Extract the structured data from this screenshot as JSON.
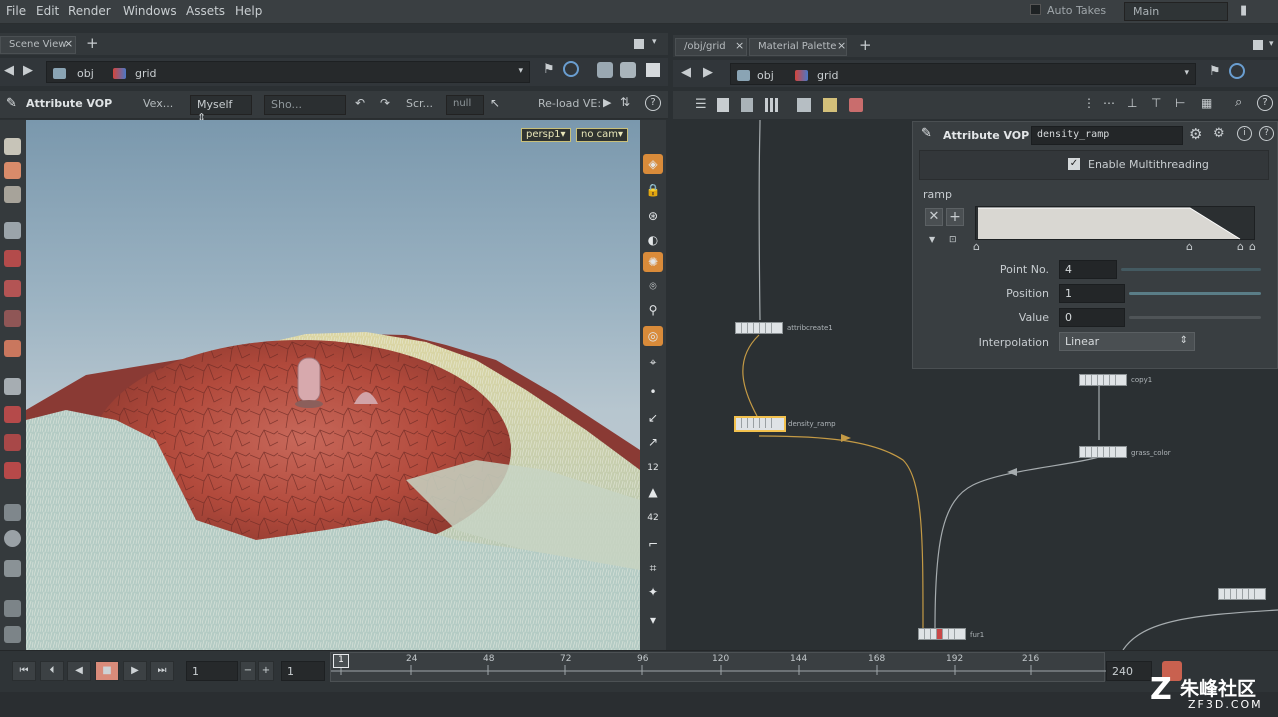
{
  "menu": [
    "File",
    "Edit",
    "Render",
    "Windows",
    "Assets",
    "Help"
  ],
  "top_right": {
    "auto_takes": "Auto Takes",
    "main_desktop": "Main"
  },
  "left_pane": {
    "tab": "Scene View",
    "path": [
      "obj",
      "grid"
    ],
    "toolbar": {
      "title": "Attribute VOP",
      "vex": "Vex...",
      "myself": "Myself",
      "sho": "Sho...",
      "scr": "Scr...",
      "null": "null",
      "reload": "Re-load VE:"
    },
    "viewport": {
      "persp": "persp1▾",
      "cam": "no cam▾"
    }
  },
  "right_pane": {
    "tabs": [
      "/obj/grid",
      "Material Palette"
    ],
    "path": [
      "obj",
      "grid"
    ],
    "nodes": {
      "attribcreate": "attribcreate1",
      "density_ramp": "density_ramp",
      "copy": "copy1",
      "grass_color": "grass_color",
      "fur": "fur1"
    },
    "params": {
      "header_type": "Attribute VOP",
      "header_name": "density_ramp",
      "multithreading": "Enable Multithreading",
      "ramp_label": "ramp",
      "point_no_label": "Point No.",
      "point_no": "4",
      "position_label": "Position",
      "position": "1",
      "value_label": "Value",
      "value": "0",
      "interp_label": "Interpolation",
      "interp": "Linear"
    }
  },
  "timeline": {
    "current_frame": "1",
    "start_field": "1",
    "end_field": "1",
    "ticks": [
      "1",
      "24",
      "48",
      "72",
      "96",
      "120",
      "144",
      "168",
      "192",
      "216"
    ],
    "end_frame": "240"
  },
  "watermark": {
    "cn": "朱峰社区",
    "url": "ZF3D.COM"
  },
  "colors": {
    "accent_orange": "#e8a24a",
    "node_selected": "#f2c14e",
    "ramp_fill": "#d9d7d2"
  }
}
